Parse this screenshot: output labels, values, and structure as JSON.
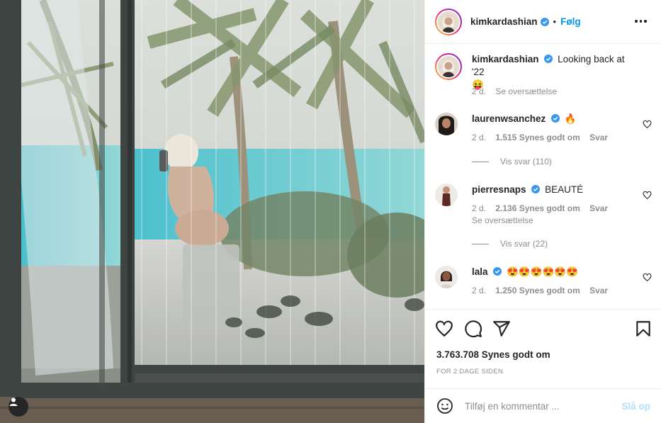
{
  "post": {
    "author": "kimkardashian",
    "follow_label": "Følg",
    "dot": "•",
    "caption_user": "kimkardashian",
    "caption_text": "Looking back at '22",
    "caption_emoji": "😝",
    "caption_age": "2 d.",
    "caption_translate": "Se oversættelse",
    "likes": "3.763.708 Synes godt om",
    "posted": "FOR 2 DAGE SIDEN",
    "add_comment_placeholder": "Tilføj en kommentar ...",
    "post_button": "Slå op"
  },
  "comments": [
    {
      "user": "laurenwsanchez",
      "text": "🔥",
      "age": "2 d.",
      "likes": "1.515 Synes godt om",
      "reply": "Svar",
      "view_replies": "Vis svar (110)"
    },
    {
      "user": "pierresnaps",
      "text": "BEAUTÉ",
      "age": "2 d.",
      "likes": "2.136 Synes godt om",
      "reply": "Svar",
      "translate": "Se oversættelse",
      "view_replies": "Vis svar (22)"
    },
    {
      "user": "lala",
      "text": "😍😍😍😍😍😍",
      "age": "2 d.",
      "likes": "1.250 Synes godt om",
      "reply": "Svar"
    }
  ],
  "colors": {
    "accent": "#0095f6",
    "verified": "#3897f0",
    "muted": "#8e8e8e",
    "text": "#262626"
  },
  "icons": [
    "more-options-icon",
    "heart-icon",
    "comment-icon",
    "share-icon",
    "bookmark-icon",
    "emoji-icon",
    "verified-badge-icon",
    "user-tag-icon"
  ]
}
